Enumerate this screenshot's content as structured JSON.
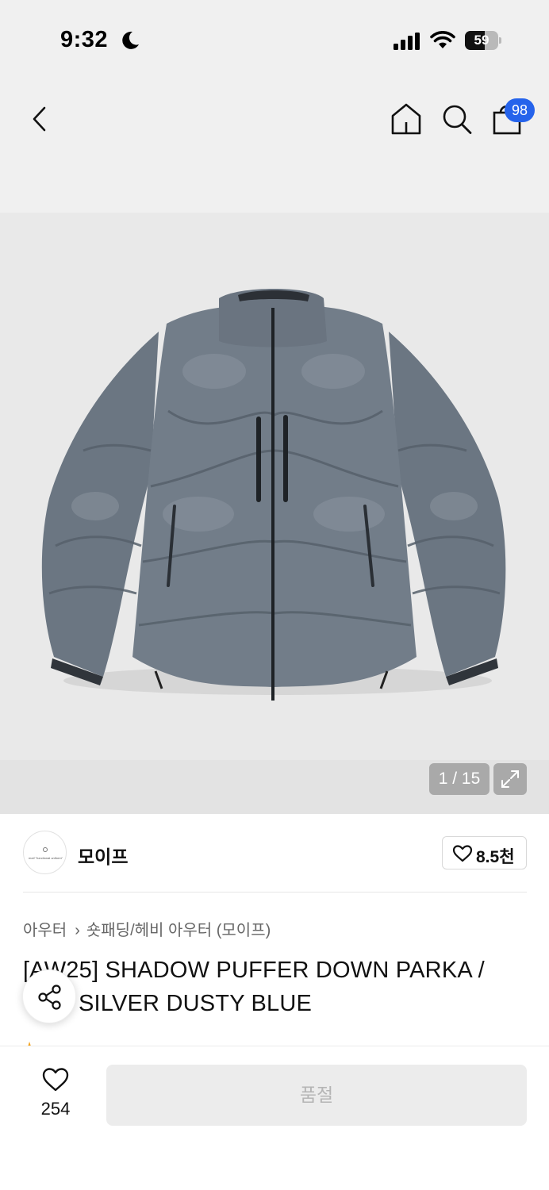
{
  "status_bar": {
    "time": "9:32",
    "battery": "59",
    "battery_level": 0.59
  },
  "header": {
    "cart_count": "98",
    "icons": [
      "back-icon",
      "home-icon",
      "search-icon",
      "bag-icon"
    ]
  },
  "gallery": {
    "counter": "1 / 15"
  },
  "brand": {
    "name": "모이프",
    "logo_text": "moif \"functional uniform\"",
    "likes": "8.5천"
  },
  "breadcrumb": {
    "category": "아우터",
    "subcategory": "숏패딩/헤비 아우터 (모이프)"
  },
  "product": {
    "title": "[AW25] SHADOW PUFFER DOWN PARKA / SHADOW SILVER DUSTY BLUE",
    "title_line1": "[AW25] SHADOW PUFFER DOWN PARKA /",
    "title_line2": "SILVER DUSTY BLUE"
  },
  "bottom_bar": {
    "wish_count": "254",
    "buy_label": "품절"
  },
  "colors": {
    "accent": "#2563eb",
    "jacket": "#6b7682"
  }
}
